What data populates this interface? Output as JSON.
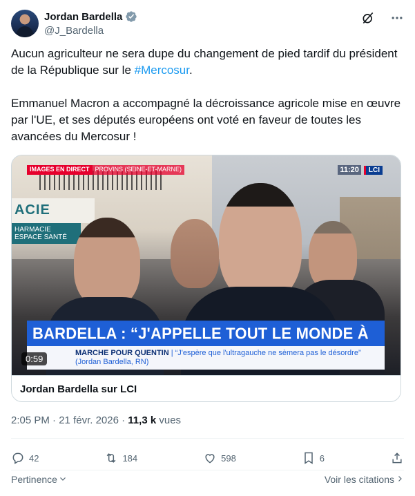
{
  "author": {
    "display_name": "Jordan Bardella",
    "handle": "@J_Bardella"
  },
  "header_icons": [
    "grok-icon",
    "more-icon"
  ],
  "tweet": {
    "text_part1": "Aucun agriculteur ne sera dupe du changement de pied tardif du président de la République sur le ",
    "hashtag": "#Mercosur",
    "text_part1_end": ".",
    "paragraph2": "Emmanuel Macron a accompagné la décroissance agricole mise en œuvre par l'UE, et ses députés européens ont voté en faveur de toutes les avancées du Mercosur !"
  },
  "video": {
    "live_label": "IMAGES EN DIRECT",
    "location_label": "PROVINS (SEINE-ET-MARNE)",
    "clock": "11:20",
    "channel": "LCI",
    "shop_sign": "ACIE",
    "shop_sign_sub": "HARMACIE\nESPACE SANTÉ",
    "banner": "BARDELLA : “J'APPELLE TOUT LE MONDE À L'APAISEMENT”",
    "sub_banner_lead": "MARCHE POUR QUENTIN",
    "sub_banner_text": "| “J'espère que l'ultragauche ne sèmera pas le désordre” (Jordan Bardella, RN)",
    "duration": "0:59"
  },
  "card": {
    "title": "Jordan Bardella sur LCI"
  },
  "meta": {
    "time": "2:05 PM",
    "separator": "·",
    "date": "21 févr. 2026",
    "views_count": "11,3 k",
    "views_label": "vues"
  },
  "actions": {
    "replies": "42",
    "reposts": "184",
    "likes": "598",
    "bookmarks": "6"
  },
  "footer": {
    "relevance": "Pertinence",
    "quotes": "Voir les citations"
  },
  "colors": {
    "accent": "#1d9bf0",
    "secondary_text": "#536471",
    "banner_blue": "#1e5fd6",
    "live_red": "#e6002d"
  }
}
